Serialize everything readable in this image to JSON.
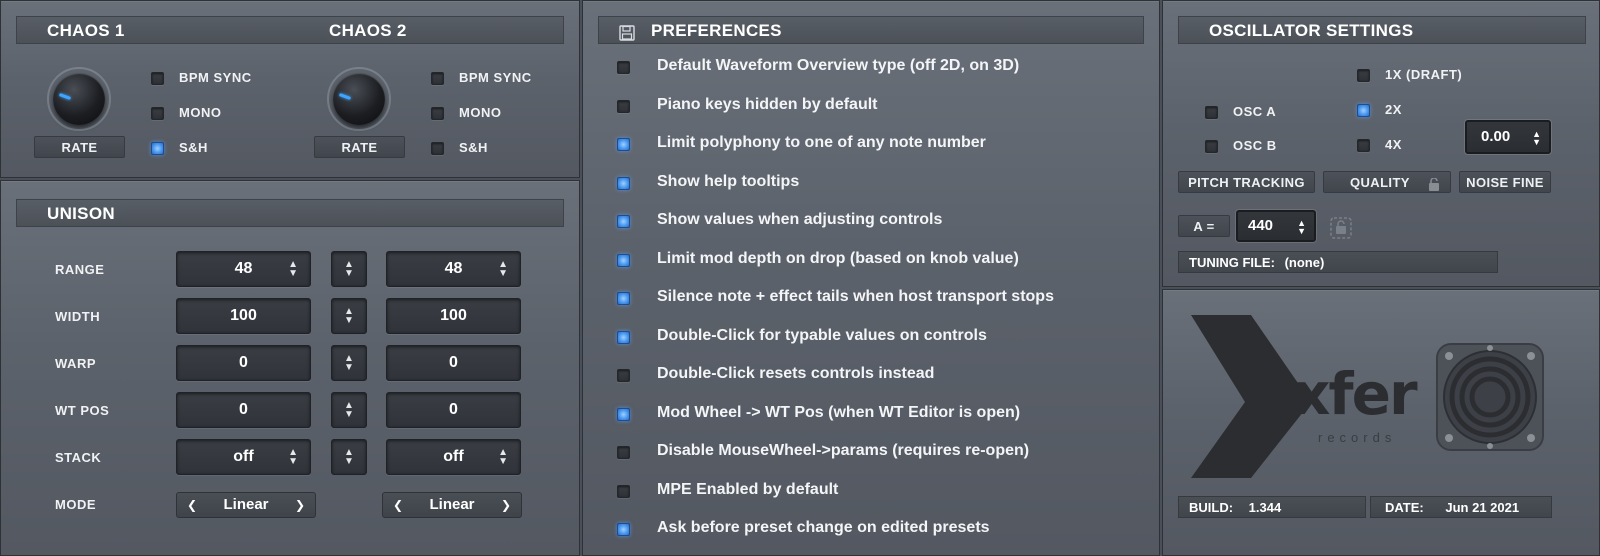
{
  "chaos": {
    "c1_title": "CHAOS 1",
    "c2_title": "CHAOS 2",
    "rate_label": "RATE",
    "bpm_sync": "BPM SYNC",
    "mono": "MONO",
    "sh": "S&H"
  },
  "unison": {
    "title": "UNISON",
    "rows": [
      {
        "label": "RANGE",
        "a": "48",
        "b": "48"
      },
      {
        "label": "WIDTH",
        "a": "100",
        "b": "100"
      },
      {
        "label": "WARP",
        "a": "0",
        "b": "0"
      },
      {
        "label": "WT POS",
        "a": "0",
        "b": "0"
      },
      {
        "label": "STACK",
        "a": "off",
        "b": "off"
      }
    ],
    "mode_label": "MODE",
    "mode_a": "Linear",
    "mode_b": "Linear"
  },
  "prefs": {
    "title": "PREFERENCES",
    "items": [
      {
        "label": "Default Waveform Overview type (off 2D, on 3D)",
        "checked": false
      },
      {
        "label": "Piano keys hidden by default",
        "checked": false
      },
      {
        "label": "Limit polyphony to one of any note number",
        "checked": true
      },
      {
        "label": "Show help tooltips",
        "checked": true
      },
      {
        "label": "Show values when adjusting controls",
        "checked": true
      },
      {
        "label": "Limit mod depth on drop (based on knob value)",
        "checked": true
      },
      {
        "label": "Silence note + effect tails when host transport stops",
        "checked": true
      },
      {
        "label": "Double-Click for typable values on controls",
        "checked": true
      },
      {
        "label": "Double-Click resets controls instead",
        "checked": false
      },
      {
        "label": "Mod Wheel -> WT Pos (when WT Editor is open)",
        "checked": true
      },
      {
        "label": "Disable MouseWheel->params (requires re-open)",
        "checked": false
      },
      {
        "label": "MPE Enabled by default",
        "checked": false
      },
      {
        "label": "Ask before preset change on edited presets",
        "checked": true
      }
    ]
  },
  "osc": {
    "title": "OSCILLATOR SETTINGS",
    "osc_a": "OSC A",
    "osc_b": "OSC B",
    "q1x": "1X (DRAFT)",
    "q2x": "2X",
    "q4x": "4X",
    "noise_value": "0.00",
    "pitch_tracking": "PITCH TRACKING",
    "quality": "QUALITY",
    "noise_fine": "NOISE FINE",
    "a_label": "A =",
    "a_value": "440",
    "tuning_label": "TUNING FILE:",
    "tuning_value": "(none)"
  },
  "about": {
    "logo": "xfer",
    "logo_sub": "records",
    "build_label": "BUILD:",
    "build_value": "1.344",
    "date_label": "DATE:",
    "date_value": "Jun 21 2021"
  }
}
